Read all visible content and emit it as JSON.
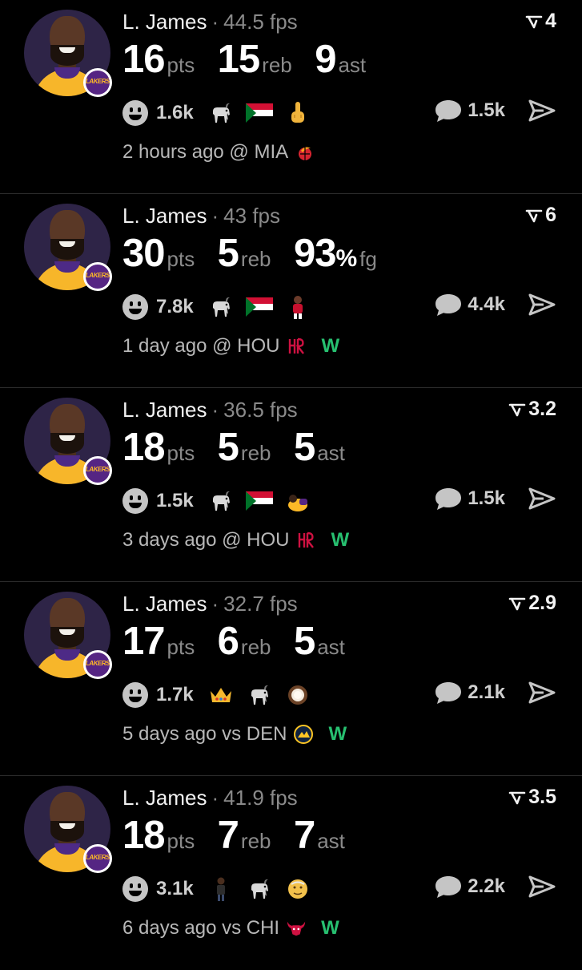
{
  "colors": {
    "background": "#000000",
    "text": "#f2f2f2",
    "muted": "#8a8a8a",
    "win": "#27c070"
  },
  "feed": [
    {
      "player": "L. James",
      "separator": "·",
      "fps": "44.5 fps",
      "rank": "4",
      "stats": [
        {
          "value": "16",
          "unit": "pts"
        },
        {
          "value": "15",
          "unit": "reb"
        },
        {
          "value": "9",
          "unit": "ast"
        }
      ],
      "reactions": "1.6k",
      "emojis": [
        "goat",
        "sudan-flag",
        "middle-finger"
      ],
      "comments": "1.5k",
      "meta": "2 hours ago @ MIA",
      "team_logo": "heat-icon",
      "result": ""
    },
    {
      "player": "L. James",
      "separator": "·",
      "fps": "43 fps",
      "rank": "6",
      "stats": [
        {
          "value": "30",
          "unit": "pts"
        },
        {
          "value": "5",
          "unit": "reb"
        },
        {
          "value": "93",
          "pct": "%",
          "unit": "fg"
        }
      ],
      "reactions": "7.8k",
      "emojis": [
        "goat",
        "sudan-flag",
        "player-figure"
      ],
      "comments": "4.4k",
      "meta": "1 day ago @ HOU",
      "team_logo": "rockets-icon",
      "result": "W"
    },
    {
      "player": "L. James",
      "separator": "·",
      "fps": "36.5 fps",
      "rank": "3.2",
      "stats": [
        {
          "value": "18",
          "unit": "pts"
        },
        {
          "value": "5",
          "unit": "reb"
        },
        {
          "value": "5",
          "unit": "ast"
        }
      ],
      "reactions": "1.5k",
      "emojis": [
        "goat",
        "sudan-flag",
        "kneeling-figure"
      ],
      "comments": "1.5k",
      "meta": "3 days ago @ HOU",
      "team_logo": "rockets-icon",
      "result": "W"
    },
    {
      "player": "L. James",
      "separator": "·",
      "fps": "32.7 fps",
      "rank": "2.9",
      "stats": [
        {
          "value": "17",
          "unit": "pts"
        },
        {
          "value": "6",
          "unit": "reb"
        },
        {
          "value": "5",
          "unit": "ast"
        }
      ],
      "reactions": "1.7k",
      "emojis": [
        "crown",
        "goat",
        "coconut"
      ],
      "comments": "2.1k",
      "meta": "5 days ago vs DEN",
      "team_logo": "nuggets-icon",
      "result": "W"
    },
    {
      "player": "L. James",
      "separator": "·",
      "fps": "41.9 fps",
      "rank": "3.5",
      "stats": [
        {
          "value": "18",
          "unit": "pts"
        },
        {
          "value": "7",
          "unit": "reb"
        },
        {
          "value": "7",
          "unit": "ast"
        }
      ],
      "reactions": "3.1k",
      "emojis": [
        "standing-figure",
        "goat",
        "old-man"
      ],
      "comments": "2.2k",
      "meta": "6 days ago vs CHI",
      "team_logo": "bulls-icon",
      "result": "W"
    }
  ]
}
